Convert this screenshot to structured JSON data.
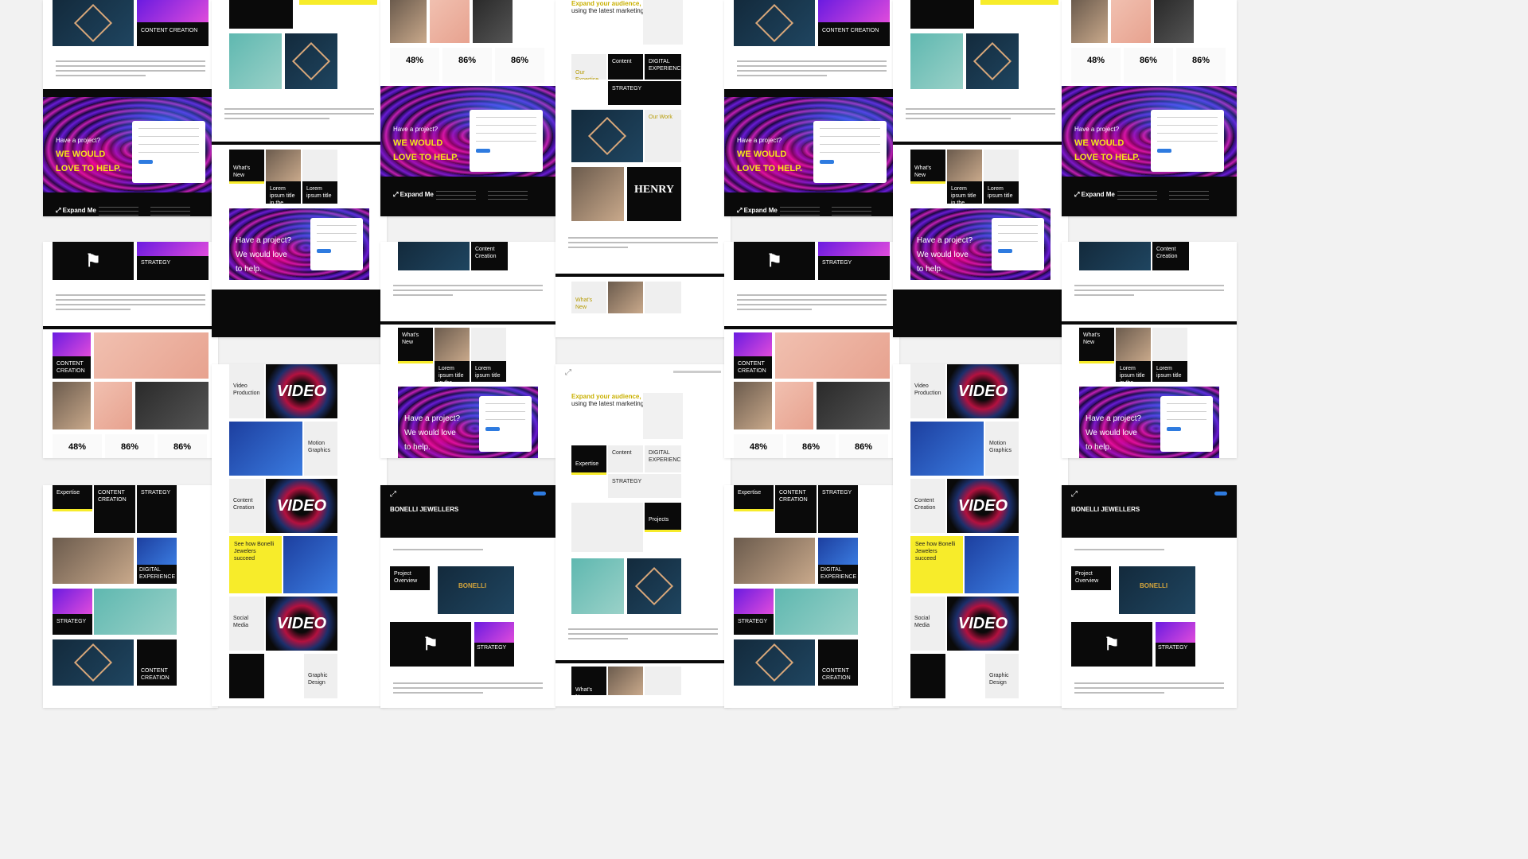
{
  "colors": {
    "background": "#f2f2f2",
    "accent_yellow": "#f7ec2a",
    "accent_blue": "#2e7be0",
    "dark": "#0a0a0a"
  },
  "hero": {
    "eyebrow": "Have a project?",
    "line1": "WE WOULD",
    "line2": "LOVE TO HELP.",
    "alt_line1": "We would love",
    "alt_line2": "to help."
  },
  "footer": {
    "brand": "Expand Me"
  },
  "stats": [
    "48%",
    "86%",
    "86%"
  ],
  "labels": {
    "content_creation": "CONTENT CREATION",
    "strategy": "STRATEGY",
    "digital_experience": "DIGITAL EXPERIENCE",
    "expertise": "Expertise",
    "our_expertise": "Our Expertise",
    "our_work": "Our Work",
    "content": "Content",
    "whats_new": "What's New",
    "video_production": "Video Production",
    "motion_graphics": "Motion Graphics",
    "content_creation_tile": "Content Creation",
    "social_media": "Social Media",
    "graphic_design": "Graphic Design",
    "video": "VIDEO",
    "see_how": "See how Bonelli Jewelers succeed",
    "projects": "Projects",
    "project_overview": "Project Overview",
    "lorem_title": "Lorem ipsum title in the night of the light",
    "lorem_title_short": "Lorem ipsum title",
    "henry": "HENRY",
    "expand_title": "Expand your audience,",
    "expand_sub": "using the latest marketing trends.",
    "bonelli_title": "BONELLI JEWELLERS",
    "bonelli_logo": "BONELLI"
  }
}
